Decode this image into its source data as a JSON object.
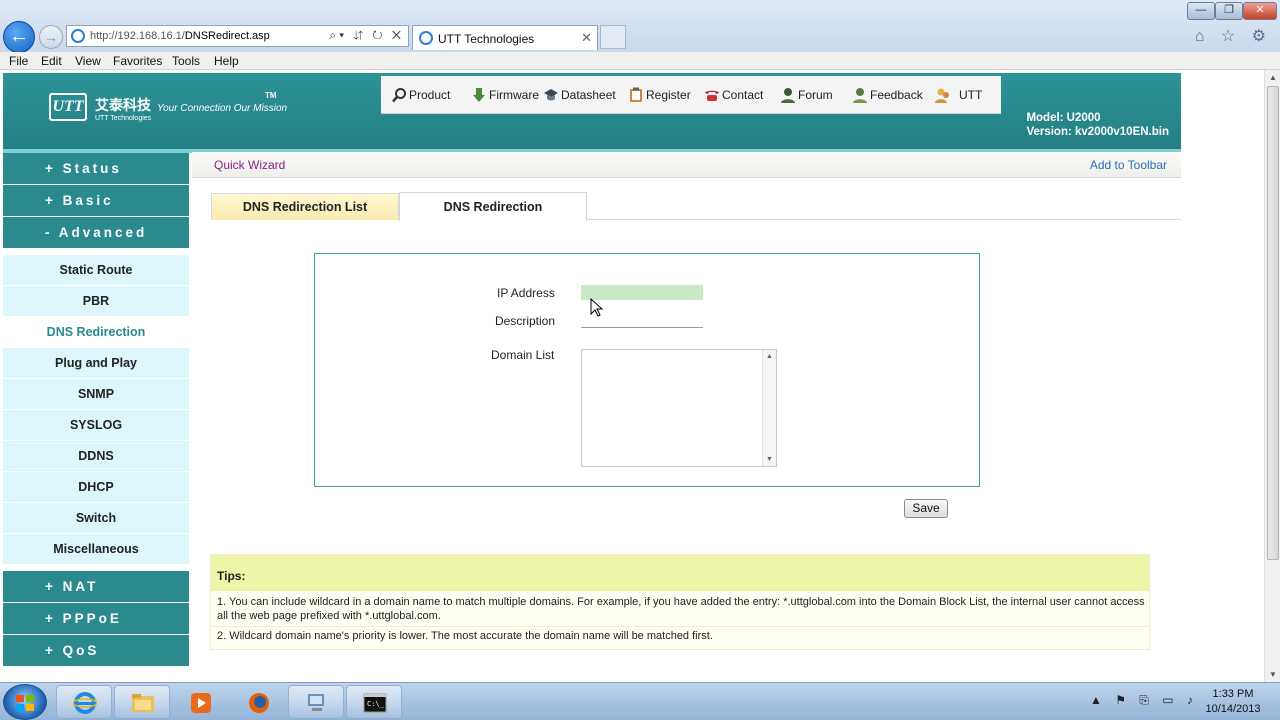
{
  "browser": {
    "url_prefix": "http://192.168.16.1/",
    "url_path": "DNSRedirect.asp",
    "tab_title": "UTT Technologies",
    "back_glyph": "←",
    "forward_glyph": "→",
    "address_controls": "⌕▾ ⇵ ↻ ✕",
    "tab_close": "✕",
    "win_min": "—",
    "win_max": "❐",
    "win_close": "✕",
    "tool_icons": "⌂ ☆ ⚙",
    "menu": [
      "File",
      "Edit",
      "View",
      "Favorites",
      "Tools",
      "Help"
    ]
  },
  "header": {
    "logo_box": "UTT",
    "logo_cn": "艾泰科技",
    "logo_en": "UTT Technologies",
    "slogan": "Your Connection  Our Mission",
    "tm": "TM",
    "model": "Model: U2000",
    "version": "Version: kv2000v10EN.bin",
    "nav": [
      "Product",
      "Firmware",
      "Datasheet",
      "Register",
      "Contact",
      "Forum",
      "Feedback",
      "UTT"
    ]
  },
  "sidebar": {
    "sections_top": [
      "+ Status",
      "+ Basic",
      "- Advanced"
    ],
    "advanced_items": [
      "Static Route",
      "PBR",
      "DNS Redirection",
      "Plug and Play",
      "SNMP",
      "SYSLOG",
      "DDNS",
      "DHCP",
      "Switch",
      "Miscellaneous"
    ],
    "active_item": "DNS Redirection",
    "sections_bottom": [
      "+ NAT",
      "+ PPPoE",
      "+ QoS"
    ]
  },
  "subbar": {
    "quick_wizard": "Quick Wizard",
    "add_to_toolbar": "Add to Toolbar"
  },
  "tabs": {
    "list": "DNS Redirection List",
    "edit": "DNS Redirection"
  },
  "form": {
    "ip_label": "IP Address",
    "ip_value": "",
    "desc_label": "Description",
    "desc_value": "",
    "domain_label": "Domain List",
    "domain_value": "",
    "save_label": "Save"
  },
  "tips": {
    "title": "Tips:",
    "tip1": "1. You can include wildcard in a domain name to match multiple domains. For example, if you have added the entry: *.uttglobal.com into the Domain Block List, the internal user cannot access all the web page prefixed with *.uttglobal.com.",
    "tip2": "2. Wildcard domain name's priority is lower. The most accurate the domain name will be matched first."
  },
  "taskbar": {
    "tray_icons": "▲ ⚑ ⎘ ▭ ♪",
    "time": "1:33 PM",
    "date": "10/14/2013"
  },
  "colors": {
    "header_teal": "#2d9397",
    "sidebar_teal": "#2a8a8d",
    "submenu_bg": "#ddf6fb",
    "ip_field": "#c8e8c6",
    "tips_header": "#eef5a8"
  }
}
